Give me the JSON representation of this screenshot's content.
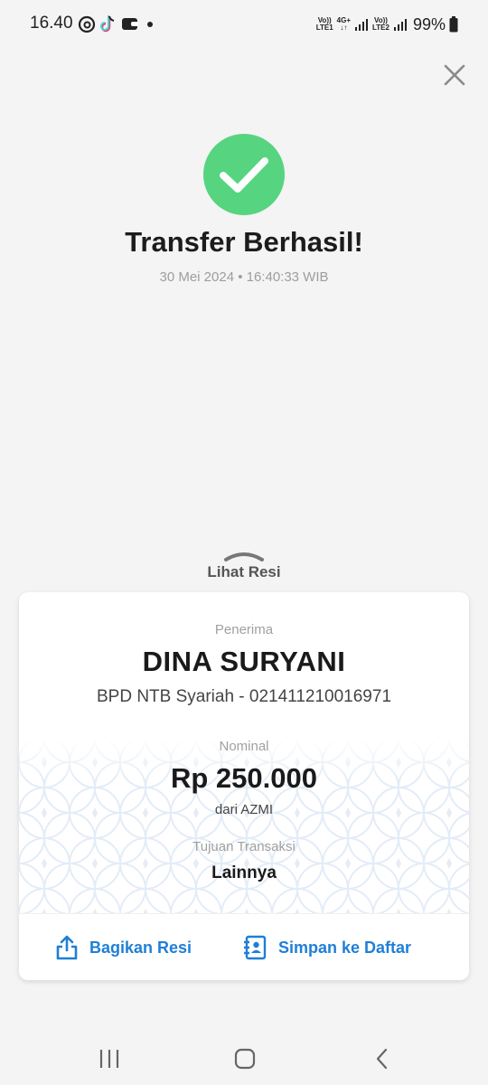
{
  "status_bar": {
    "time": "16.40",
    "sim1_label_top": "Vo))",
    "sim1_label_bottom": "LTE1",
    "net_label_top": "4G+",
    "net_label_bottom": "↓↑",
    "sim2_label_top": "Vo))",
    "sim2_label_bottom": "LTE2",
    "battery": "99%",
    "icons": [
      "threads-icon",
      "tiktok-icon",
      "wallet-icon",
      "dot-icon",
      "signal-icon",
      "battery-icon"
    ]
  },
  "success": {
    "title": "Transfer Berhasil!",
    "datetime": "30 Mei 2024 • 16:40:33 WIB",
    "badge_color": "#56d480"
  },
  "receipt_toggle": {
    "label": "Lihat Resi"
  },
  "receipt": {
    "recipient_label": "Penerima",
    "recipient_name": "DINA SURYANI",
    "bank_account": "BPD NTB Syariah - 021411210016971",
    "amount_label": "Nominal",
    "amount": "Rp 250.000",
    "from": "dari AZMI",
    "purpose_label": "Tujuan Transaksi",
    "purpose": "Lainnya"
  },
  "actions": {
    "share_label": "Bagikan Resi",
    "save_label": "Simpan ke Daftar",
    "accent": "#1f7fd6"
  },
  "nav": {
    "icons": [
      "recent-apps-icon",
      "home-icon",
      "back-icon"
    ]
  }
}
